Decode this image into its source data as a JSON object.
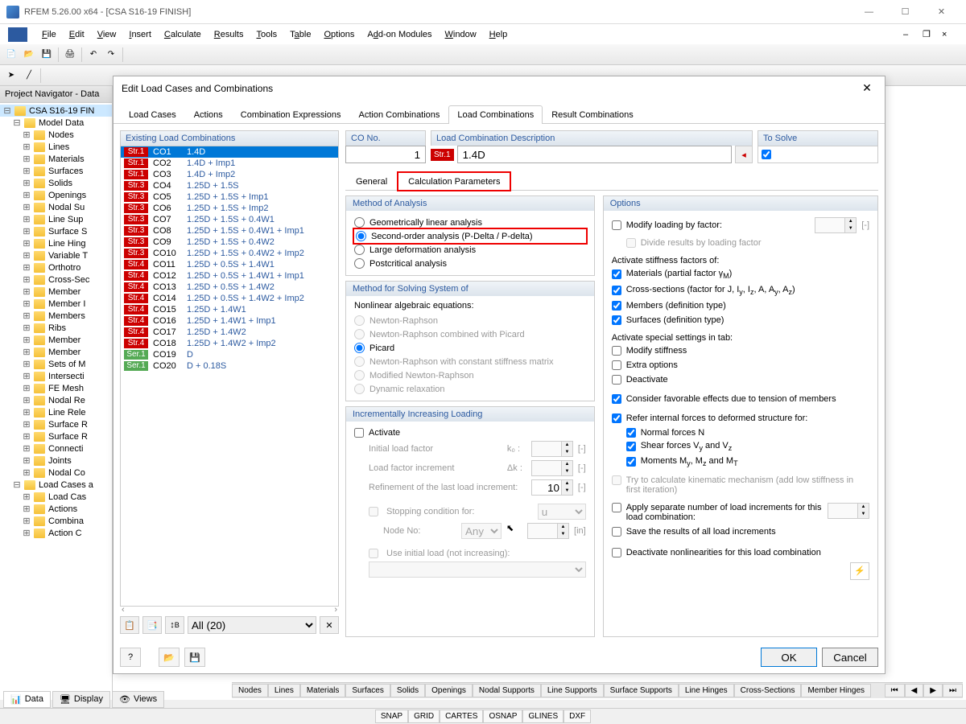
{
  "titlebar": {
    "title": "RFEM 5.26.00 x64 - [CSA S16-19 FINISH]"
  },
  "menu": [
    "File",
    "Edit",
    "View",
    "Insert",
    "Calculate",
    "Results",
    "Tools",
    "Table",
    "Options",
    "Add-on Modules",
    "Window",
    "Help"
  ],
  "navigator": {
    "header": "Project Navigator - Data",
    "root": "CSA S16-19 FIN",
    "modeldata": "Model Data",
    "items": [
      "Nodes",
      "Lines",
      "Materials",
      "Surfaces",
      "Solids",
      "Openings",
      "Nodal Su",
      "Line Sup",
      "Surface S",
      "Line Hing",
      "Variable T",
      "Orthotro",
      "Cross-Sec",
      "Member",
      "Member I",
      "Members",
      "Ribs",
      "Member",
      "Member",
      "Sets of M",
      "Intersecti",
      "FE Mesh",
      "Nodal Re",
      "Line Rele",
      "Surface R",
      "Surface R",
      "Connecti",
      "Joints",
      "Nodal Co"
    ],
    "loadcases": "Load Cases a",
    "lcitems": [
      "Load Cas",
      "Actions",
      "Combina",
      "Action C"
    ]
  },
  "viewtabs": {
    "data": "Data",
    "display": "Display",
    "views": "Views"
  },
  "dialog": {
    "title": "Edit Load Cases and Combinations",
    "tabs": [
      "Load Cases",
      "Actions",
      "Combination Expressions",
      "Action Combinations",
      "Load Combinations",
      "Result Combinations"
    ],
    "existing_label": "Existing Load Combinations",
    "combos": [
      {
        "tag": "Str.1",
        "tagcls": "str1",
        "id": "CO1",
        "desc": "1.4D",
        "sel": true
      },
      {
        "tag": "Str.1",
        "tagcls": "str1",
        "id": "CO2",
        "desc": "1.4D + Imp1"
      },
      {
        "tag": "Str.1",
        "tagcls": "str1",
        "id": "CO3",
        "desc": "1.4D + Imp2"
      },
      {
        "tag": "Str.3",
        "tagcls": "str3",
        "id": "CO4",
        "desc": "1.25D + 1.5S"
      },
      {
        "tag": "Str.3",
        "tagcls": "str3",
        "id": "CO5",
        "desc": "1.25D + 1.5S + Imp1"
      },
      {
        "tag": "Str.3",
        "tagcls": "str3",
        "id": "CO6",
        "desc": "1.25D + 1.5S + Imp2"
      },
      {
        "tag": "Str.3",
        "tagcls": "str3",
        "id": "CO7",
        "desc": "1.25D + 1.5S + 0.4W1"
      },
      {
        "tag": "Str.3",
        "tagcls": "str3",
        "id": "CO8",
        "desc": "1.25D + 1.5S + 0.4W1 + Imp1"
      },
      {
        "tag": "Str.3",
        "tagcls": "str3",
        "id": "CO9",
        "desc": "1.25D + 1.5S + 0.4W2"
      },
      {
        "tag": "Str.3",
        "tagcls": "str3",
        "id": "CO10",
        "desc": "1.25D + 1.5S + 0.4W2 + Imp2"
      },
      {
        "tag": "Str.4",
        "tagcls": "str4",
        "id": "CO11",
        "desc": "1.25D + 0.5S + 1.4W1"
      },
      {
        "tag": "Str.4",
        "tagcls": "str4",
        "id": "CO12",
        "desc": "1.25D + 0.5S + 1.4W1 + Imp1"
      },
      {
        "tag": "Str.4",
        "tagcls": "str4",
        "id": "CO13",
        "desc": "1.25D + 0.5S + 1.4W2"
      },
      {
        "tag": "Str.4",
        "tagcls": "str4",
        "id": "CO14",
        "desc": "1.25D + 0.5S + 1.4W2 + Imp2"
      },
      {
        "tag": "Str.4",
        "tagcls": "str4",
        "id": "CO15",
        "desc": "1.25D + 1.4W1"
      },
      {
        "tag": "Str.4",
        "tagcls": "str4",
        "id": "CO16",
        "desc": "1.25D + 1.4W1 + Imp1"
      },
      {
        "tag": "Str.4",
        "tagcls": "str4",
        "id": "CO17",
        "desc": "1.25D + 1.4W2"
      },
      {
        "tag": "Str.4",
        "tagcls": "str4",
        "id": "CO18",
        "desc": "1.25D + 1.4W2 + Imp2"
      },
      {
        "tag": "Ser.1",
        "tagcls": "ser1",
        "id": "CO19",
        "desc": "D"
      },
      {
        "tag": "Ser.1",
        "tagcls": "ser1",
        "id": "CO20",
        "desc": "D + 0.18S"
      }
    ],
    "allfilter": "All (20)",
    "cono_label": "CO No.",
    "cono_value": "1",
    "desc_label": "Load Combination Description",
    "desc_tag": "Str.1",
    "desc_value": "1.4D",
    "solve_label": "To Solve",
    "subtabs": {
      "general": "General",
      "calc": "Calculation Parameters"
    },
    "method": {
      "header": "Method of Analysis",
      "opts": [
        "Geometrically linear analysis",
        "Second-order analysis (P-Delta / P-delta)",
        "Large deformation analysis",
        "Postcritical analysis"
      ]
    },
    "solving": {
      "header": "Method for Solving System of",
      "sub": "Nonlinear algebraic equations:",
      "opts": [
        "Newton-Raphson",
        "Newton-Raphson combined with Picard",
        "Picard",
        "Newton-Raphson with constant stiffness matrix",
        "Modified Newton-Raphson",
        "Dynamic relaxation"
      ]
    },
    "incre": {
      "header": "Incrementally Increasing Loading",
      "activate": "Activate",
      "rows": {
        "ilf": "Initial load factor",
        "ilf_sym": "k₀ :",
        "lfi": "Load factor increment",
        "lfi_sym": "Δk :",
        "refine": "Refinement of the last load increment:",
        "refine_val": "10",
        "stop": "Stopping condition for:",
        "stop_val": "u",
        "node": "Node No:",
        "node_val": "Any",
        "node_unit": "[in]",
        "useinit": "Use initial load (not increasing):"
      }
    },
    "options": {
      "header": "Options",
      "modify": "Modify loading by factor:",
      "divide": "Divide results by loading factor",
      "activate_label": "Activate stiffness factors of:",
      "mat": "Materials (partial factor γM)",
      "cs": "Cross-sections (factor for J, Iy, Iz, A, Ay, Az)",
      "mem": "Members (definition type)",
      "surf": "Surfaces (definition type)",
      "special_label": "Activate special settings in tab:",
      "mstiff": "Modify stiffness",
      "extra": "Extra options",
      "deact": "Deactivate",
      "favor": "Consider favorable effects due to tension of members",
      "refer": "Refer internal forces to deformed structure for:",
      "nf": "Normal forces N",
      "sf": "Shear forces Vy and Vz",
      "mom": "Moments My, Mz and MT",
      "kinematic": "Try to calculate kinematic mechanism (add low stiffness in first iteration)",
      "sepincre": "Apply separate number of load increments for this load combination:",
      "saveres": "Save the results of all load increments",
      "deactnl": "Deactivate nonlinearities for this load combination"
    },
    "buttons": {
      "ok": "OK",
      "cancel": "Cancel"
    }
  },
  "bottomtabs": [
    "Nodes",
    "Lines",
    "Materials",
    "Surfaces",
    "Solids",
    "Openings",
    "Nodal Supports",
    "Line Supports",
    "Surface Supports",
    "Line Hinges",
    "Cross-Sections",
    "Member Hinges"
  ],
  "status": [
    "SNAP",
    "GRID",
    "CARTES",
    "OSNAP",
    "GLINES",
    "DXF"
  ]
}
